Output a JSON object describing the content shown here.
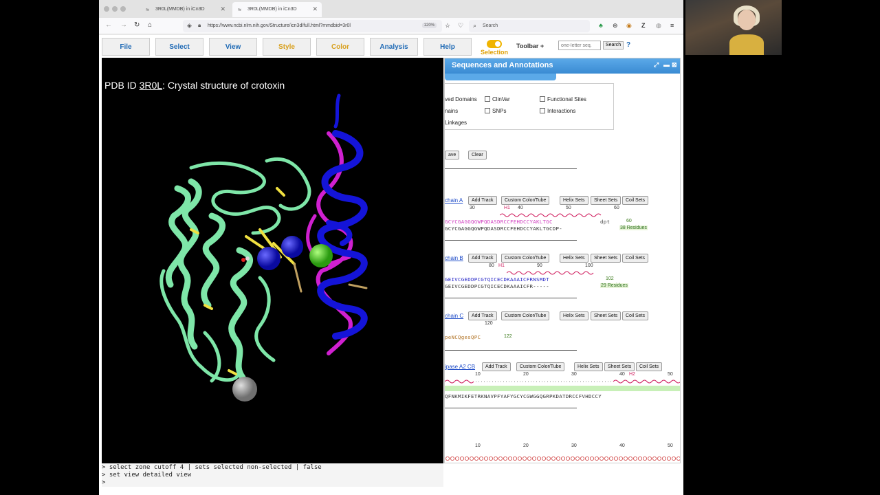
{
  "browser": {
    "tabs": [
      {
        "label": "3R0L(MMDB) in iCn3D",
        "active": false
      },
      {
        "label": "3R0L(MMDB) in iCn3D",
        "active": true
      }
    ],
    "url": "https://www.ncbi.nlm.nih.gov/Structure/icn3d/full.html?mmdbid=3r0l",
    "zoom": "120%",
    "search_placeholder": "Search"
  },
  "menu": {
    "items": [
      "File",
      "Select",
      "View",
      "Style",
      "Color",
      "Analysis",
      "Help"
    ],
    "selection_label": "Selection",
    "toolbar_label": "Toolbar",
    "toolbar_plus": "+",
    "seq_placeholder": "one-letter seq.",
    "search_btn": "Search",
    "help_q": "?"
  },
  "viewer": {
    "title_prefix": "PDB ID ",
    "pdb_id": "3R0L",
    "title_suffix": ": Crystal structure of crotoxin"
  },
  "console": {
    "lines": [
      "> select zone cutoff 4 | sets selected non-selected | false",
      "> set view detailed view",
      ">"
    ]
  },
  "panel": {
    "title": "Sequences and Annotations",
    "annotations": {
      "conserved_domains": "ved Domains",
      "clinvar": "ClinVar",
      "functional_sites": "Functional Sites",
      "domains": "nains",
      "snps": "SNPs",
      "interactions": "Interactions",
      "linkages": "Linkages"
    },
    "save_btn": "ave",
    "clear_btn": "Clear",
    "track_buttons": [
      "Add Track",
      "Custom Color/Tube",
      "Helix Sets",
      "Sheet Sets",
      "Coil Sets"
    ],
    "chains": [
      {
        "link": "chain A",
        "ticks": [
          "30",
          "40",
          "50",
          "60"
        ],
        "helix_label": "H1",
        "seq_top": "GCYCGAGGQGWPQDASDRCCFEHDCCYAKLTGC",
        "seq_top_tail": "dpt",
        "end_num": "60",
        "seq_bottom": "GCYCGAGGQGWPQDASDRCCFEHDCCYAKLTGCDP-",
        "residues": "38 Residues"
      },
      {
        "link": "chain B",
        "ticks": [
          "80",
          "90",
          "100"
        ],
        "helix_label": "H1",
        "seq_top": "GEIVCGEDDPCGTQICECDKAAAICFRNSMDT",
        "end_num": "102",
        "seq_bottom": "GEIVCGEDDPCGTQICECDKAAAICFR-----",
        "residues": "29 Residues"
      },
      {
        "link": "chain C",
        "ticks": [
          "120"
        ],
        "seq_top": "peNCQgesQPC",
        "end_num": "122"
      },
      {
        "link": "ipase A2 CB",
        "ticks": [
          "10",
          "20",
          "30",
          "40",
          "50"
        ],
        "helix_label": "H2",
        "seq_top": "QFNKMIKFETRKNAVPFYAFYGCYCGWGGQGRPKDATDRCCFVHDCCY"
      }
    ],
    "bottom_ticks": [
      "10",
      "20",
      "30",
      "40",
      "50"
    ]
  }
}
